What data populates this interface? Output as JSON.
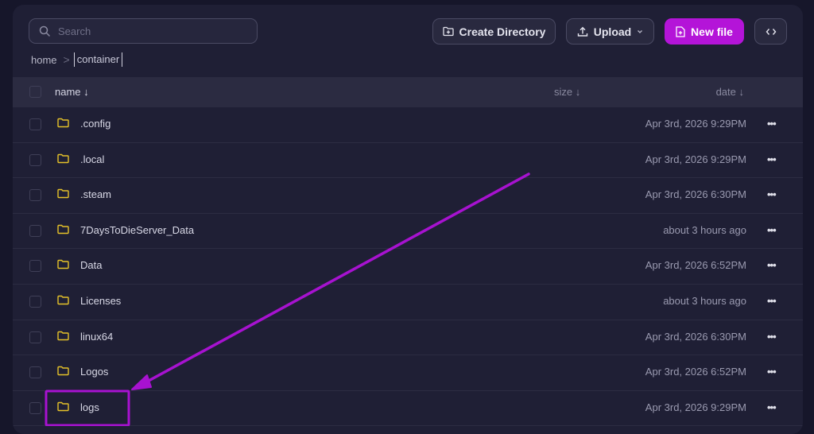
{
  "search": {
    "placeholder": "Search"
  },
  "toolbar": {
    "create_directory_label": "Create Directory",
    "upload_label": "Upload",
    "new_file_label": "New file"
  },
  "breadcrumb": {
    "home": "home",
    "current": "container"
  },
  "table": {
    "columns": {
      "name": "name ↓",
      "size": "size ↓",
      "date": "date ↓"
    },
    "rows": [
      {
        "name": ".config",
        "date": "Apr 3rd, 2026 9:29PM"
      },
      {
        "name": ".local",
        "date": "Apr 3rd, 2026 9:29PM"
      },
      {
        "name": ".steam",
        "date": "Apr 3rd, 2026 6:30PM"
      },
      {
        "name": "7DaysToDieServer_Data",
        "date": "about 3 hours ago"
      },
      {
        "name": "Data",
        "date": "Apr 3rd, 2026 6:52PM"
      },
      {
        "name": "Licenses",
        "date": "about 3 hours ago"
      },
      {
        "name": "linux64",
        "date": "Apr 3rd, 2026 6:30PM"
      },
      {
        "name": "Logos",
        "date": "Apr 3rd, 2026 6:52PM"
      },
      {
        "name": "logs",
        "date": "Apr 3rd, 2026 9:29PM"
      }
    ],
    "more_label": "•••"
  },
  "icons": {
    "search": "search-icon",
    "create_directory": "folder-plus-icon",
    "upload": "upload-icon",
    "upload_caret": "chevron-down-icon",
    "new_file": "file-plus-icon",
    "code": "code-icon",
    "folder": "folder-icon"
  },
  "colors": {
    "accent": "#b414d8",
    "folder": "#e6c229",
    "annotation": "#a712d0"
  }
}
